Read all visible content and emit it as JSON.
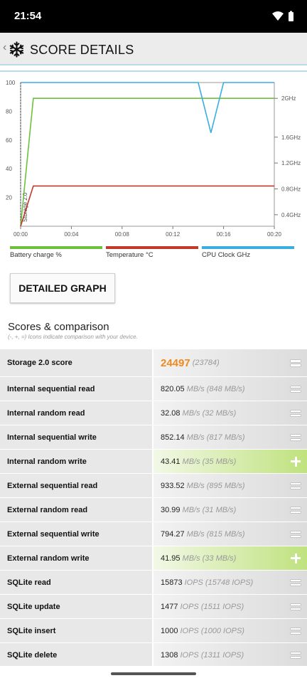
{
  "status": {
    "time": "21:54"
  },
  "appbar": {
    "title": "SCORE DETAILS",
    "back_icon": "chevron-left-icon",
    "logo_icon": "snowflake-icon"
  },
  "chart_data": {
    "type": "line",
    "xlabel": "",
    "ylabel": "",
    "x_ticks": [
      "00:00",
      "00:04",
      "00:08",
      "00:12",
      "00:16",
      "00:20"
    ],
    "x_range_minutes": [
      0,
      20
    ],
    "y_left_ticks": [
      "20",
      "40",
      "60",
      "80",
      "100"
    ],
    "y_left_range": [
      0,
      100
    ],
    "y_right_ticks": [
      "0.4GHz",
      "0.8GHz",
      "1.2GHz",
      "1.6GHz",
      "2GHz"
    ],
    "marker": {
      "label": "Storage 2.0",
      "x_minutes": 0
    },
    "series": [
      {
        "name": "Battery charge %",
        "color": "#6cc23c",
        "x_minutes": [
          0,
          1,
          20
        ],
        "values": [
          0,
          89,
          89
        ]
      },
      {
        "name": "Temperature °C",
        "color": "#c0392b",
        "x_minutes": [
          0,
          1,
          20
        ],
        "values": [
          0,
          28,
          28
        ]
      },
      {
        "name": "CPU Clock GHz",
        "color": "#3aaee0",
        "x_minutes": [
          0,
          14,
          15,
          16,
          20
        ],
        "values": [
          100,
          100,
          65,
          100,
          100
        ]
      }
    ],
    "legend": "bottom",
    "grid": false
  },
  "detailed_button": "DETAILED GRAPH",
  "scores": {
    "title": "Scores & comparison",
    "subtitle": "(-, +, =) Icons indicate comparison with your device.",
    "rows": [
      {
        "label": "Storage 2.0 score",
        "value": "24497",
        "unit": "(23784)",
        "cmp": "="
      },
      {
        "label": "Internal sequential read",
        "value": "820.05",
        "unit": "MB/s (848 MB/s)",
        "cmp": "="
      },
      {
        "label": "Internal random read",
        "value": "32.08",
        "unit": "MB/s (32 MB/s)",
        "cmp": "="
      },
      {
        "label": "Internal sequential write",
        "value": "852.14",
        "unit": "MB/s (817 MB/s)",
        "cmp": "="
      },
      {
        "label": "Internal random write",
        "value": "43.41",
        "unit": "MB/s (35 MB/s)",
        "cmp": "+"
      },
      {
        "label": "External sequential read",
        "value": "933.52",
        "unit": "MB/s (895 MB/s)",
        "cmp": "="
      },
      {
        "label": "External random read",
        "value": "30.99",
        "unit": "MB/s (31 MB/s)",
        "cmp": "="
      },
      {
        "label": "External sequential write",
        "value": "794.27",
        "unit": "MB/s (815 MB/s)",
        "cmp": "="
      },
      {
        "label": "External random write",
        "value": "41.95",
        "unit": "MB/s (33 MB/s)",
        "cmp": "+"
      },
      {
        "label": "SQLite read",
        "value": "15873",
        "unit": "IOPS (15748 IOPS)",
        "cmp": "="
      },
      {
        "label": "SQLite update",
        "value": "1477",
        "unit": "IOPS (1511 IOPS)",
        "cmp": "="
      },
      {
        "label": "SQLite insert",
        "value": "1000",
        "unit": "IOPS (1000 IOPS)",
        "cmp": "="
      },
      {
        "label": "SQLite delete",
        "value": "1308",
        "unit": "IOPS (1311 IOPS)",
        "cmp": "="
      }
    ]
  }
}
